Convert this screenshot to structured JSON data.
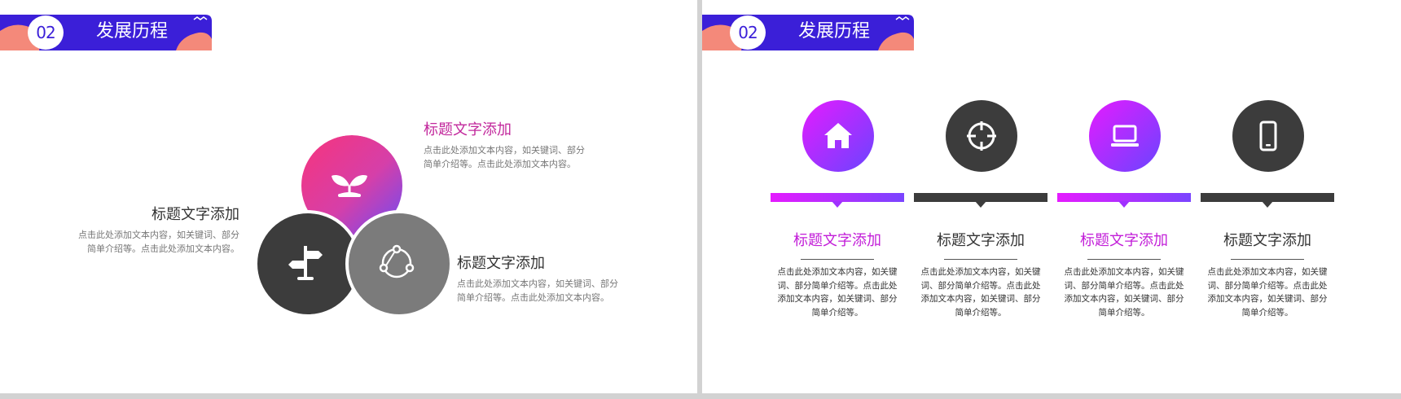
{
  "colors": {
    "banner_blue": "#3b1fd8",
    "accent_salmon": "#f4897a",
    "magenta": "#e0168b",
    "purple": "#8a2cff",
    "dark_gray": "#3c3c3c",
    "mid_gray": "#7b7b7b"
  },
  "slides": [
    {
      "badge": "02",
      "title": "发展历程",
      "blocks": [
        {
          "title": "标题文字添加",
          "desc": "点击此处添加文本内容，如关键词、部分简单介绍等。点击此处添加文本内容。"
        },
        {
          "title": "标题文字添加",
          "desc": "点击此处添加文本内容，如关键词、部分简单介绍等。点击此处添加文本内容。"
        },
        {
          "title": "标题文字添加",
          "desc": "点击此处添加文本内容，如关键词、部分简单介绍等。点击此处添加文本内容。"
        }
      ],
      "circle_icons": [
        "sprout-icon",
        "signpost-icon",
        "network-icon"
      ]
    },
    {
      "badge": "02",
      "title": "发展历程",
      "columns": [
        {
          "icon": "home-icon",
          "title": "标题文字添加",
          "desc": "点击此处添加文本内容，如关键词、部分简单介绍等。点击此处添加文本内容，如关键词、部分简单介绍等。"
        },
        {
          "icon": "crosshair-icon",
          "title": "标题文字添加",
          "desc": "点击此处添加文本内容，如关键词、部分简单介绍等。点击此处添加文本内容，如关键词、部分简单介绍等。"
        },
        {
          "icon": "laptop-icon",
          "title": "标题文字添加",
          "desc": "点击此处添加文本内容，如关键词、部分简单介绍等。点击此处添加文本内容，如关键词、部分简单介绍等。"
        },
        {
          "icon": "phone-icon",
          "title": "标题文字添加",
          "desc": "点击此处添加文本内容，如关键词、部分简单介绍等。点击此处添加文本内容，如关键词、部分简单介绍等。"
        }
      ]
    }
  ]
}
